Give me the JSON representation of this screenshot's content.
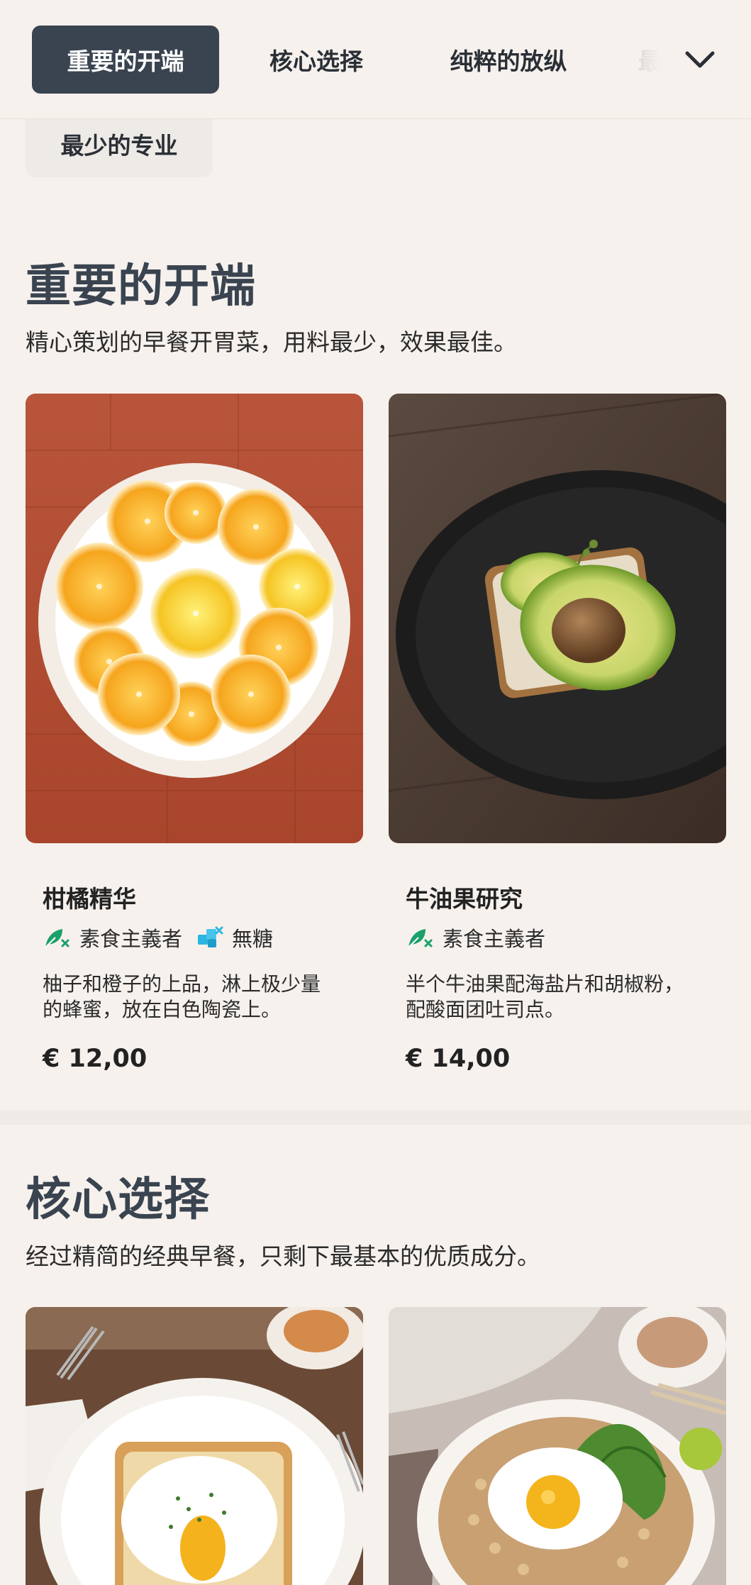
{
  "nav": {
    "tabs": [
      {
        "label": "重要的开端",
        "active": true
      },
      {
        "label": "核心选择",
        "active": false
      },
      {
        "label": "纯粹的放纵",
        "active": false
      },
      {
        "label": "最",
        "active": false
      }
    ],
    "overflow_chip": "最少的专业",
    "expand_icon": "chevron-down-icon"
  },
  "sections": [
    {
      "title": "重要的开端",
      "subtitle": "精心策划的早餐开胃菜，用料最少，效果最佳。",
      "items": [
        {
          "name": "柑橘精华",
          "tags": [
            {
              "icon": "leaf-icon",
              "label": "素食主義者"
            },
            {
              "icon": "sugar-free-icon",
              "label": "無糖"
            }
          ],
          "description_lines": [
            "柚子和橙子的上品，淋上极少量",
            "的蜂蜜，放在白色陶瓷上。"
          ],
          "price": "€ 12,00"
        },
        {
          "name": "牛油果研究",
          "tags": [
            {
              "icon": "leaf-icon",
              "label": "素食主義者"
            }
          ],
          "description_lines": [
            "半个牛油果配海盐片和胡椒粉，",
            "配酸面团吐司点。"
          ],
          "price": "€ 14,00"
        }
      ]
    },
    {
      "title": "核心选择",
      "subtitle": "经过精简的经典早餐，只剩下最基本的优质成分。",
      "items": []
    }
  ],
  "colors": {
    "background": "#f6f1ed",
    "active_tab": "#3a4450",
    "vegan_icon": "#1aa06b",
    "sugar_free_icon": "#2bb5e0",
    "section_title": "#3a4450"
  }
}
